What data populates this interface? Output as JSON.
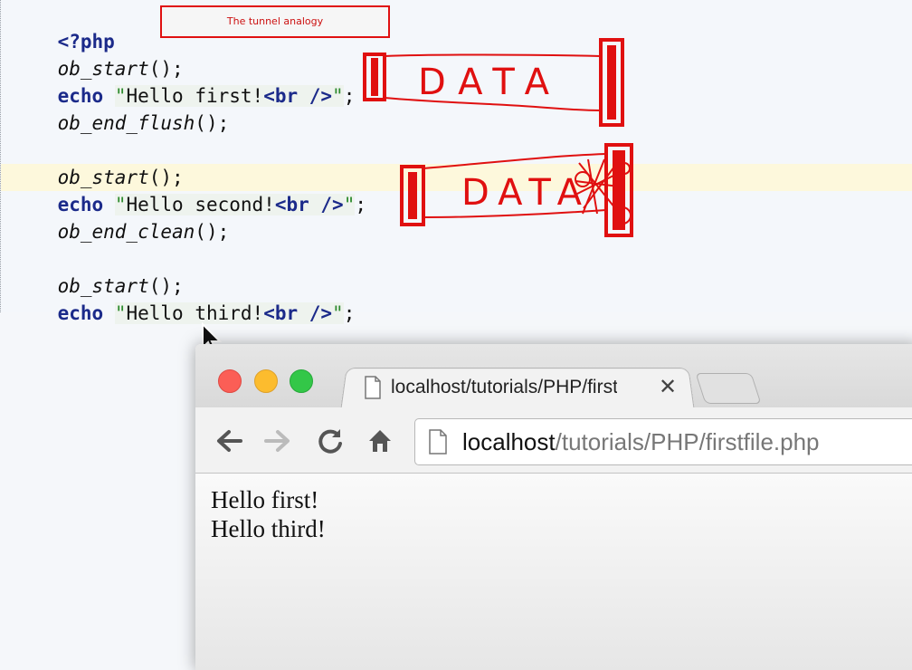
{
  "editor": {
    "lines": [
      {
        "kw": "<?php"
      },
      {
        "fn": "ob_start",
        "rest": "();"
      },
      {
        "kw": "echo",
        "str": "Hello first!",
        "tag": "<br />",
        "end": ";"
      },
      {
        "fn": "ob_end_flush",
        "rest": "();"
      },
      {
        "fn": "ob_start",
        "rest": "();"
      },
      {
        "kw": "echo",
        "str": "Hello second!",
        "tag": "<br />",
        "end": ";"
      },
      {
        "fn": "ob_end_clean",
        "rest": "();"
      },
      {
        "fn": "ob_start",
        "rest": "();"
      },
      {
        "kw": "echo",
        "str": "Hello third!",
        "tag": "<br />",
        "end": ";"
      }
    ]
  },
  "annotation": {
    "title": "The tunnel analogy",
    "tunnel_label_1": "DATA",
    "tunnel_label_2": "DATA"
  },
  "browser": {
    "tab_title": "localhost/tutorials/PHP/firstfile.php",
    "url_host": "localhost",
    "url_path": "/tutorials/PHP/firstfile.php",
    "output": [
      "Hello first!",
      "Hello third!"
    ]
  },
  "colors": {
    "annotation_red": "#e01010",
    "keyword_blue": "#1b2a8a",
    "highlight_row": "#fdf8dc"
  },
  "icons": {
    "back": "arrow-left-icon",
    "forward": "arrow-right-icon",
    "reload": "reload-icon",
    "home": "home-icon",
    "page": "page-icon",
    "close": "close-icon",
    "pointer": "mouse-pointer-icon"
  }
}
